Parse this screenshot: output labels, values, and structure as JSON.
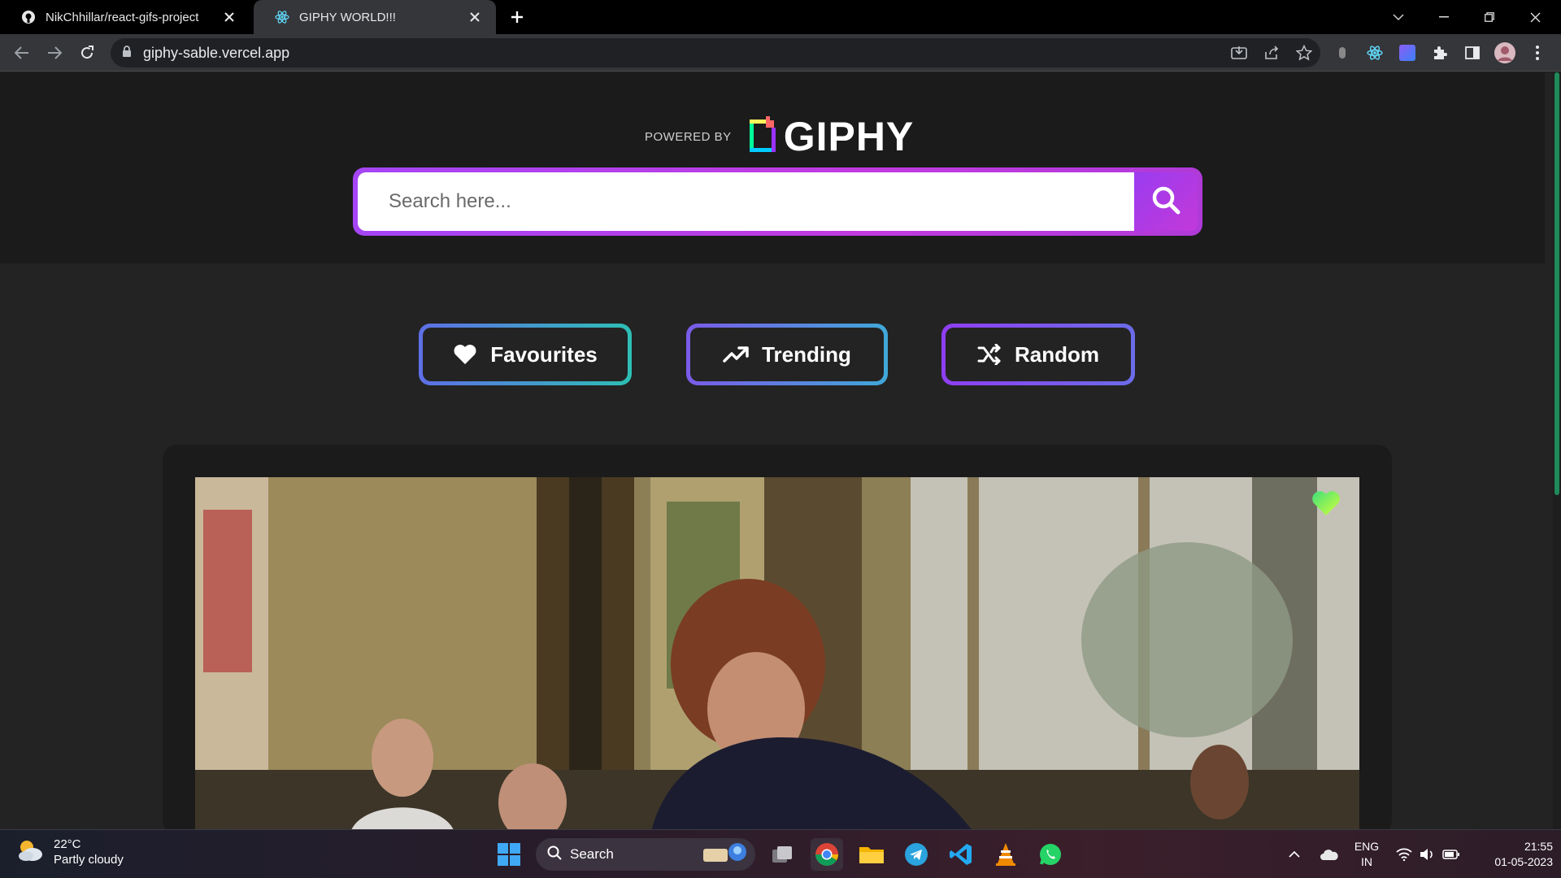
{
  "browser": {
    "tabs": [
      {
        "title": "NikChhillar/react-gifs-project",
        "active": false
      },
      {
        "title": "GIPHY WORLD!!!",
        "active": true
      }
    ],
    "url": "giphy-sable.vercel.app"
  },
  "header": {
    "powered_by": "POWERED BY",
    "brand": "GIPHY"
  },
  "search": {
    "placeholder": "Search here..."
  },
  "nav": {
    "favourites": "Favourites",
    "trending": "Trending",
    "random": "Random"
  },
  "taskbar": {
    "weather_temp": "22°C",
    "weather_desc": "Partly cloudy",
    "search_label": "Search",
    "lang_top": "ENG",
    "lang_bottom": "IN",
    "time": "21:55",
    "date": "01-05-2023"
  },
  "colors": {
    "accent_purple": "#a545f5",
    "fav_heart": "#6ee84a",
    "scroll_thumb": "#1f8a5a"
  }
}
